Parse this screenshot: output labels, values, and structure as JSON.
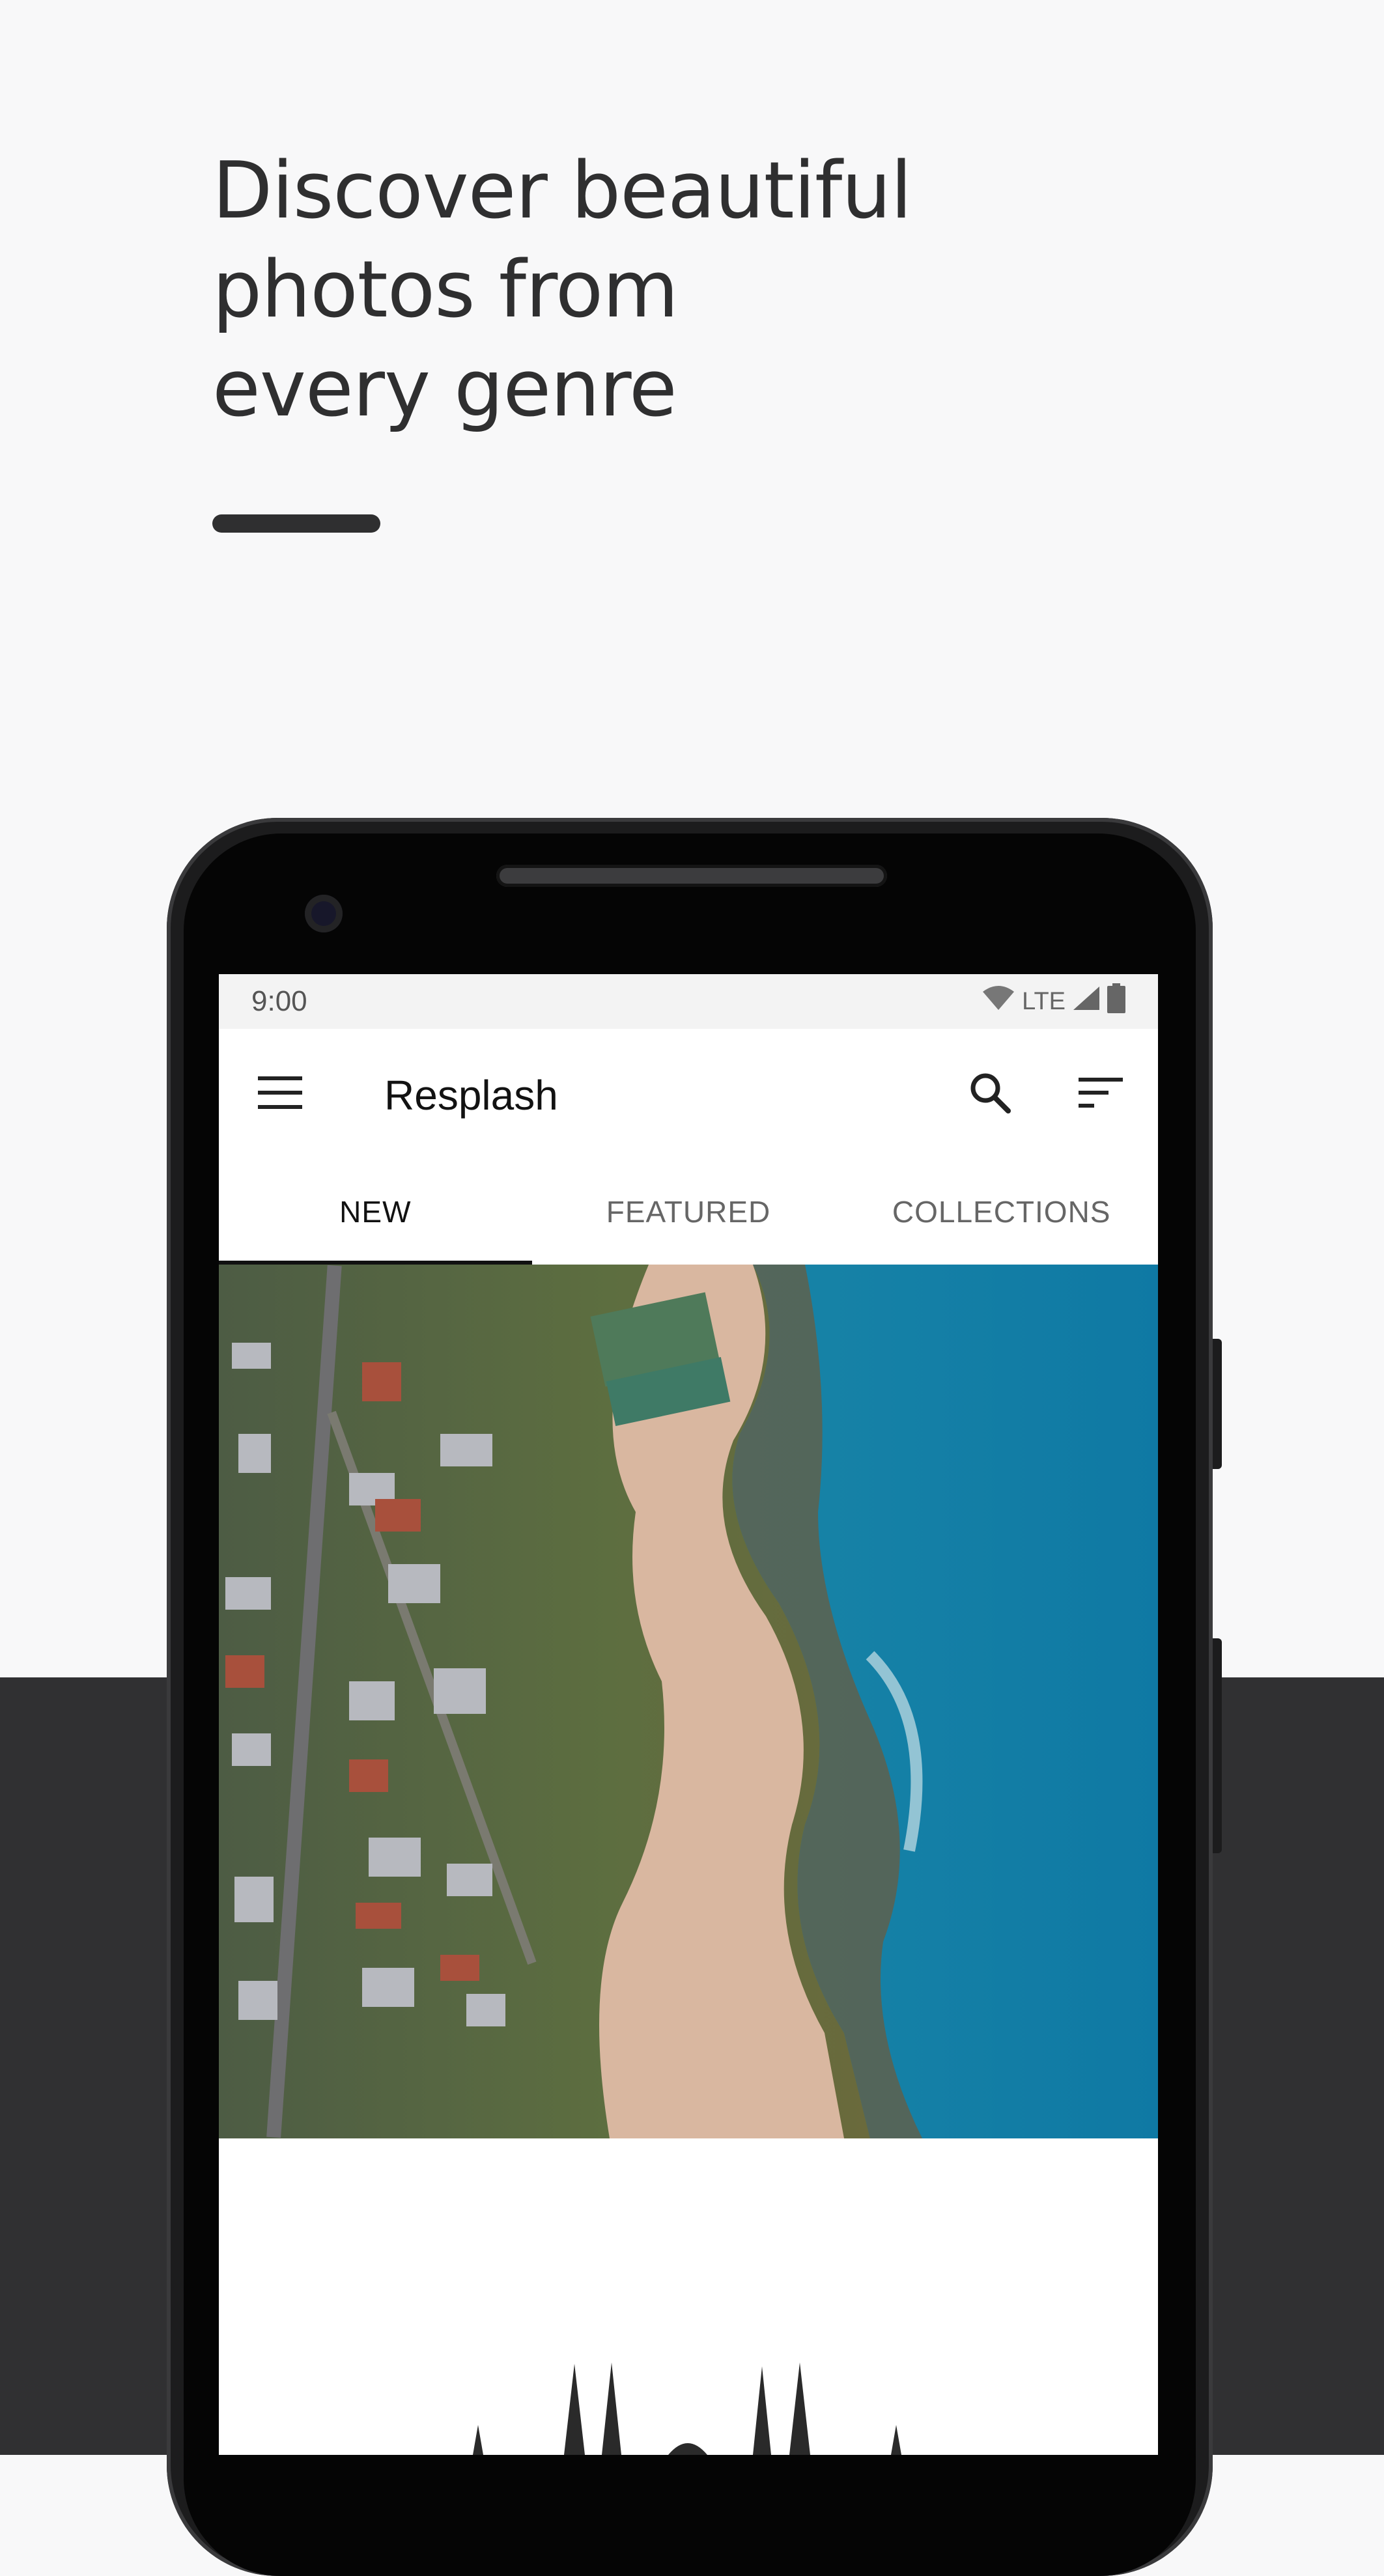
{
  "headline": {
    "lines": [
      "Discover beautiful",
      " photos from",
      "every genre"
    ]
  },
  "status_bar": {
    "time": "9:00",
    "network": "LTE"
  },
  "app_bar": {
    "title": "Resplash"
  },
  "tabs": [
    {
      "label": "NEW",
      "active": true
    },
    {
      "label": "FEATURED",
      "active": false
    },
    {
      "label": "COLLECTIONS",
      "active": false
    }
  ],
  "icons": {
    "menu": "menu-icon",
    "search": "search-icon",
    "sort": "sort-icon",
    "wifi": "wifi-icon",
    "signal": "signal-icon",
    "battery": "battery-icon"
  },
  "colors": {
    "page_background": "#f8f8f9",
    "dark_band": "#303032",
    "headline_text": "#2f2f30",
    "active_tab": "#111111"
  }
}
